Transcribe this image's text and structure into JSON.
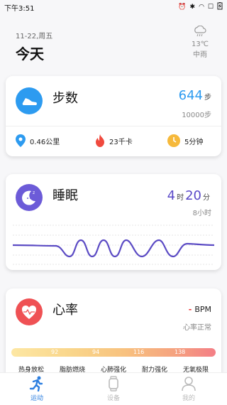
{
  "status_bar": {
    "time": "下午3:51"
  },
  "header": {
    "date": "11-22,周五",
    "title": "今天",
    "weather": {
      "temp": "13℃",
      "condition": "中雨"
    }
  },
  "steps": {
    "title": "步数",
    "value": "644",
    "unit": "步",
    "goal": "10000步",
    "distance": "0.46公里",
    "calories": "23千卡",
    "duration": "5分钟"
  },
  "sleep": {
    "title": "睡眠",
    "hours": "4",
    "hours_unit": "时",
    "minutes": "20",
    "minutes_unit": "分",
    "goal": "8小时"
  },
  "heart": {
    "title": "心率",
    "value_placeholder": "-",
    "unit": "BPM",
    "status": "心率正常",
    "thresholds": [
      "92",
      "94",
      "116",
      "138"
    ],
    "zones": [
      "热身放松",
      "脂肪燃烧",
      "心肺强化",
      "耐力强化",
      "无氧极限"
    ]
  },
  "bottom_nav": {
    "items": [
      "运动",
      "设备",
      "我的"
    ],
    "active": "运动",
    "active_color": "#2d7fe0"
  },
  "colors": {
    "steps_accent": "#2d9bf0",
    "sleep_accent": "#6c5bd8",
    "heart_accent": "#ef5154"
  }
}
